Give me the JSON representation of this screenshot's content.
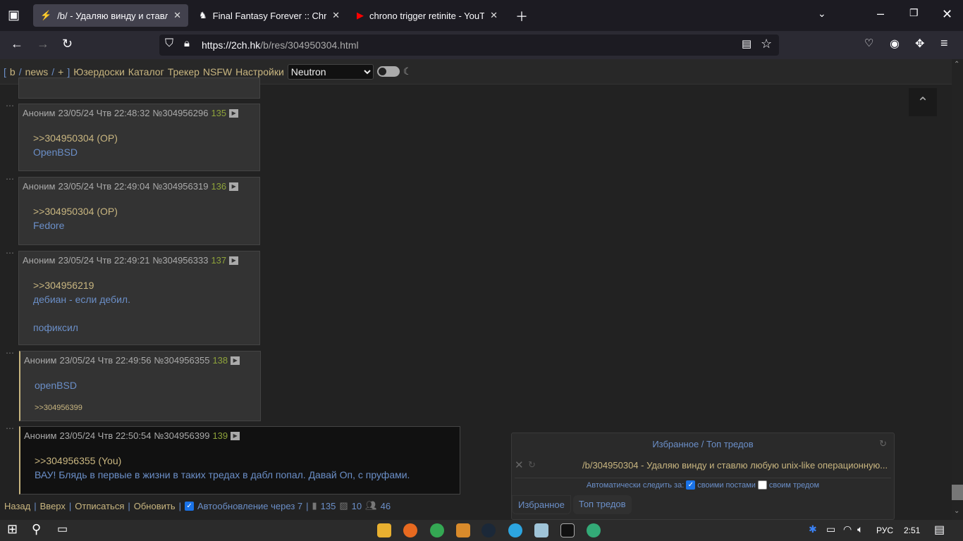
{
  "browser": {
    "tabs": [
      {
        "title": "/b/ - Удаляю винду и ставлю любую",
        "icon": "lightning-icon",
        "active": true
      },
      {
        "title": "Final Fantasy Forever :: Chrono",
        "icon": "moogle-icon"
      },
      {
        "title": "chrono trigger retinite - YouTub",
        "icon": "youtube-icon"
      }
    ],
    "url_host": "https://2ch.hk",
    "url_path": "/b/res/304950304.html"
  },
  "boardbar": {
    "open": "[",
    "b": "b",
    "slash1": "/",
    "news": "news",
    "slash2": "/",
    "plus": "+",
    "close": "]",
    "links": [
      "Юзердоски",
      "Каталог",
      "Трекер",
      "NSFW",
      "Настройки"
    ],
    "theme": "Neutron"
  },
  "posts": [
    {
      "author": "Аноним",
      "date": "23/05/24 Чтв 22:48:32",
      "id": "№304956296",
      "num": "135",
      "reply": ">>304950304 (OP)",
      "lines": [
        "OpenBSD"
      ]
    },
    {
      "author": "Аноним",
      "date": "23/05/24 Чтв 22:49:04",
      "id": "№304956319",
      "num": "136",
      "reply": ">>304950304 (OP)",
      "lines": [
        "Fedore"
      ]
    },
    {
      "author": "Аноним",
      "date": "23/05/24 Чтв 22:49:21",
      "id": "№304956333",
      "num": "137",
      "reply": ">>304956219",
      "lines": [
        "дебиан - если дебил.",
        "",
        "пофиксил"
      ]
    },
    {
      "author": "Аноним",
      "date": "23/05/24 Чтв 22:49:56",
      "id": "№304956355",
      "num": "138",
      "lines": [
        "openBSD"
      ],
      "backlink": ">>304956399"
    },
    {
      "author": "Аноним",
      "date": "23/05/24 Чтв 22:50:54",
      "id": "№304956399",
      "num": "139",
      "reply": ">>304956355 (You)",
      "lines": [
        "ВАУ! Блядь в первые в жизни в таких тредах в дабл попал. Давай Оп, с пруфами."
      ]
    }
  ],
  "footer": {
    "back": "Назад",
    "top": "Вверх",
    "unsub": "Отписаться",
    "refresh": "Обновить",
    "auto": "Автообновление через 7",
    "posts": "135",
    "images": "10",
    "users": "46"
  },
  "fav": {
    "title": "Избранное / Топ тредов",
    "thread": "/b/304950304 - Удаляю винду и ставлю любую unix-like операционную...",
    "auto_label": "Автоматически следить за:",
    "own_posts": "своими постами",
    "own_thread": "своим тредом",
    "tabs": [
      "Избранное",
      "Топ тредов"
    ]
  },
  "taskbar": {
    "lang": "РУС",
    "time": "2:51"
  }
}
